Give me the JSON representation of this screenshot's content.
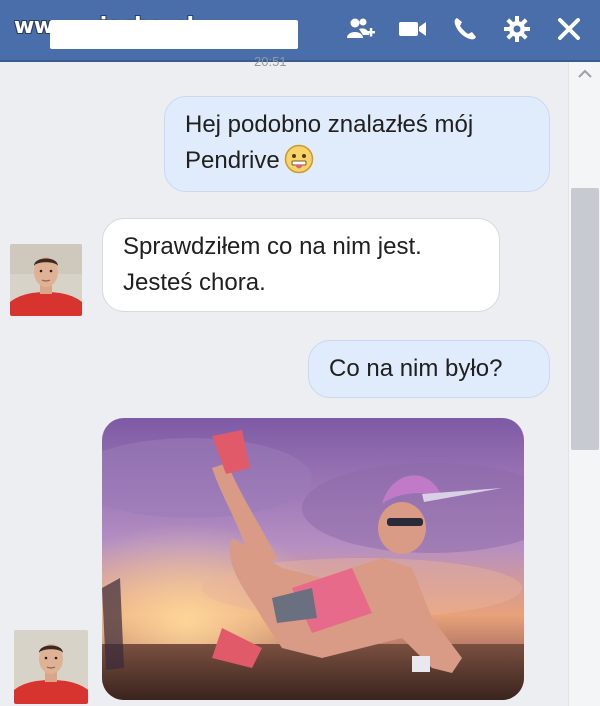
{
  "watermark": "www.wiocha.pl",
  "header": {
    "icons": [
      "add-friend-icon",
      "video-call-icon",
      "phone-icon",
      "settings-gear-icon",
      "close-icon"
    ]
  },
  "timestamp": "20:51",
  "messages": [
    {
      "direction": "outgoing",
      "lines": [
        "Hej podobno znalazłeś mój",
        "Pendrive"
      ],
      "emoji": "tongue-out-emoji"
    },
    {
      "direction": "incoming",
      "lines": [
        "Sprawdziłem co na nim jest.",
        "Jesteś chora."
      ]
    },
    {
      "direction": "outgoing",
      "lines": [
        "Co na nim było?"
      ]
    },
    {
      "direction": "incoming",
      "type": "photo",
      "description_icon": "unicorn-costume-photo"
    }
  ],
  "colors": {
    "header": "#4a6ea9",
    "outgoing_bubble": "#e0ecfb",
    "incoming_bubble": "#ffffff",
    "chat_background": "#eceef2"
  }
}
